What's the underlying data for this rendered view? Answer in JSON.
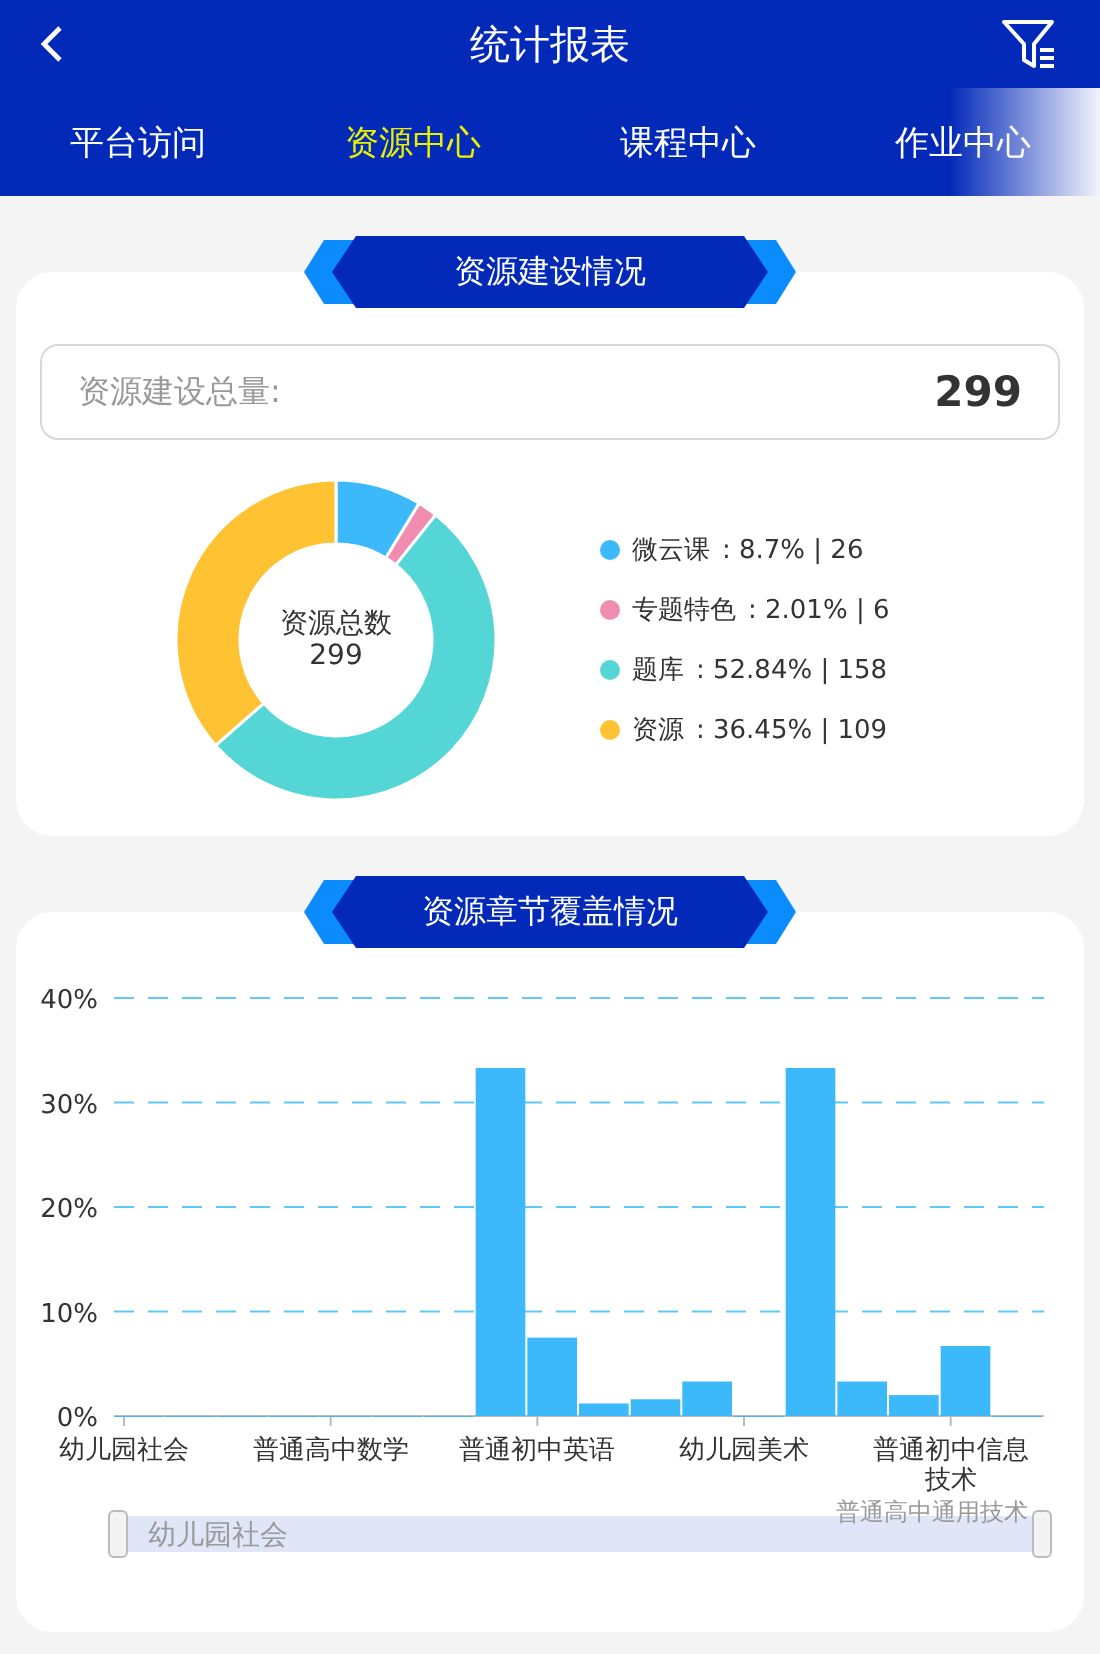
{
  "header": {
    "title": "统计报表"
  },
  "tabs": [
    {
      "label": "平台访问",
      "selected": false
    },
    {
      "label": "资源中心",
      "selected": true
    },
    {
      "label": "课程中心",
      "selected": false
    },
    {
      "label": "作业中心",
      "selected": false
    }
  ],
  "construction": {
    "title": "资源建设情况",
    "total_label": "资源建设总量:",
    "total_value": "299",
    "center_label": "资源总数",
    "center_value": "299",
    "legend": [
      {
        "detail": ": 8.7% | 26",
        "color": "#3bb9fb"
      },
      {
        "detail": ": 2.01% | 6",
        "color": "#ef8cb0"
      },
      {
        "detail": ": 52.84% | 158",
        "color": "#55d6d6"
      },
      {
        "detail": ": 36.45% | 109",
        "color": "#ffc233"
      }
    ],
    "chart_data": {
      "type": "donut",
      "categories": [
        "微云课",
        "专题特色",
        "题库",
        "资源"
      ],
      "values": [
        8.7,
        2.01,
        52.84,
        36.45
      ]
    }
  },
  "coverage": {
    "title": "资源章节覆盖情况",
    "chart_data": {
      "type": "bar",
      "categories": [
        "幼儿园社会",
        null,
        null,
        null,
        "普通高中数学",
        null,
        null,
        null,
        "普通初中英语",
        null,
        null,
        null,
        "幼儿园美术",
        null,
        null,
        null,
        "普通初中信息技术",
        null
      ],
      "values": [
        0,
        0,
        0,
        0,
        0,
        0,
        0,
        33.3,
        7.5,
        1.2,
        1.6,
        3.3,
        0,
        33.3,
        3.3,
        2.0,
        6.7,
        0
      ],
      "ylim": [
        0,
        40
      ],
      "grid": true,
      "yticks": [
        {
          "value": 0,
          "label": "0%"
        },
        {
          "value": 10,
          "label": "10%"
        },
        {
          "value": 20,
          "label": "20%"
        },
        {
          "value": 30,
          "label": "30%"
        },
        {
          "value": 40,
          "label": "40%"
        }
      ]
    },
    "zoom": {
      "start_label": "幼儿园社会",
      "end_label": "普通高中通用技术"
    }
  }
}
